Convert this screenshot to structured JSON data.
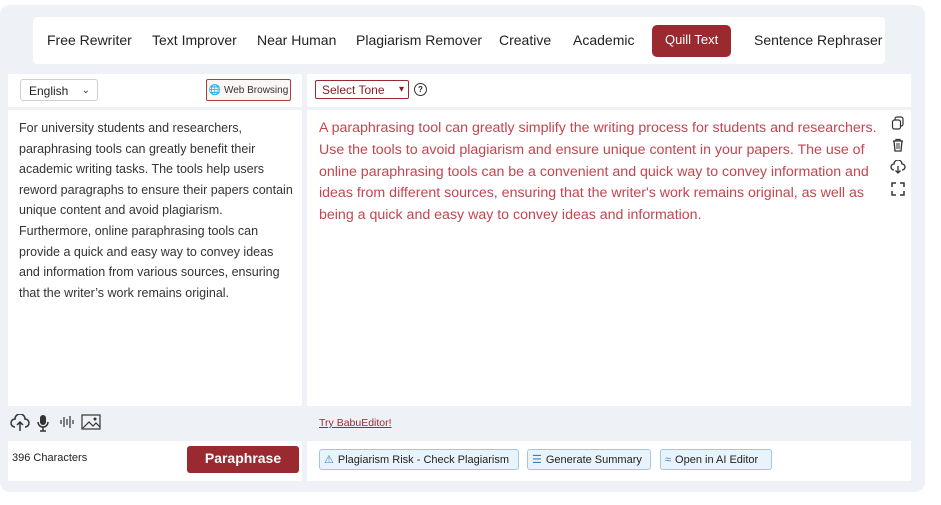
{
  "tabs": [
    {
      "label": "Free Rewriter",
      "active": false
    },
    {
      "label": "Text Improver",
      "active": false
    },
    {
      "label": "Near Human",
      "active": false
    },
    {
      "label": "Plagiarism Remover",
      "active": false
    },
    {
      "label": "Creative",
      "active": false
    },
    {
      "label": "Academic",
      "active": false
    },
    {
      "label": "Quill Text",
      "active": true
    },
    {
      "label": "Sentence Rephraser",
      "active": false
    }
  ],
  "input": {
    "language": "English",
    "web_browsing": "Web Browsing",
    "text": "For university students and researchers, paraphrasing tools can greatly benefit their academic writing tasks. The tools help users reword paragraphs to ensure their papers contain unique content and avoid plagiarism. Furthermore, online paraphrasing tools can provide a quick and easy way to convey ideas and information from various sources, ensuring that the writer’s work remains original.",
    "char_count": "396 Characters",
    "paraphrase_label": "Paraphrase"
  },
  "output": {
    "tone": "Select Tone",
    "text": "A paraphrasing tool can greatly simplify the writing process for students and researchers. Use the tools to avoid plagiarism and ensure unique content in your papers. The use of online paraphrasing tools can be a convenient and quick way to convey information and ideas from different sources, ensuring that the writer's work remains original, as well as being a quick and easy way to convey ideas and information.",
    "try_link": "Try BabuEditor!",
    "actions": {
      "plagiarism": "Plagiarism Risk - Check Plagiarism",
      "summary": "Generate Summary",
      "ai_editor": "Open in AI Editor"
    }
  },
  "icons": {
    "copy": "copy-icon",
    "delete": "trash-icon",
    "download": "download-icon",
    "fullscreen": "expand-icon",
    "upload": "upload-icon",
    "mic": "mic-icon",
    "audio": "audio-wave-icon",
    "image": "image-icon"
  },
  "colors": {
    "accent": "#9a2a2f",
    "output_text": "#c4454f",
    "pill_bg": "#e8f3fb"
  }
}
